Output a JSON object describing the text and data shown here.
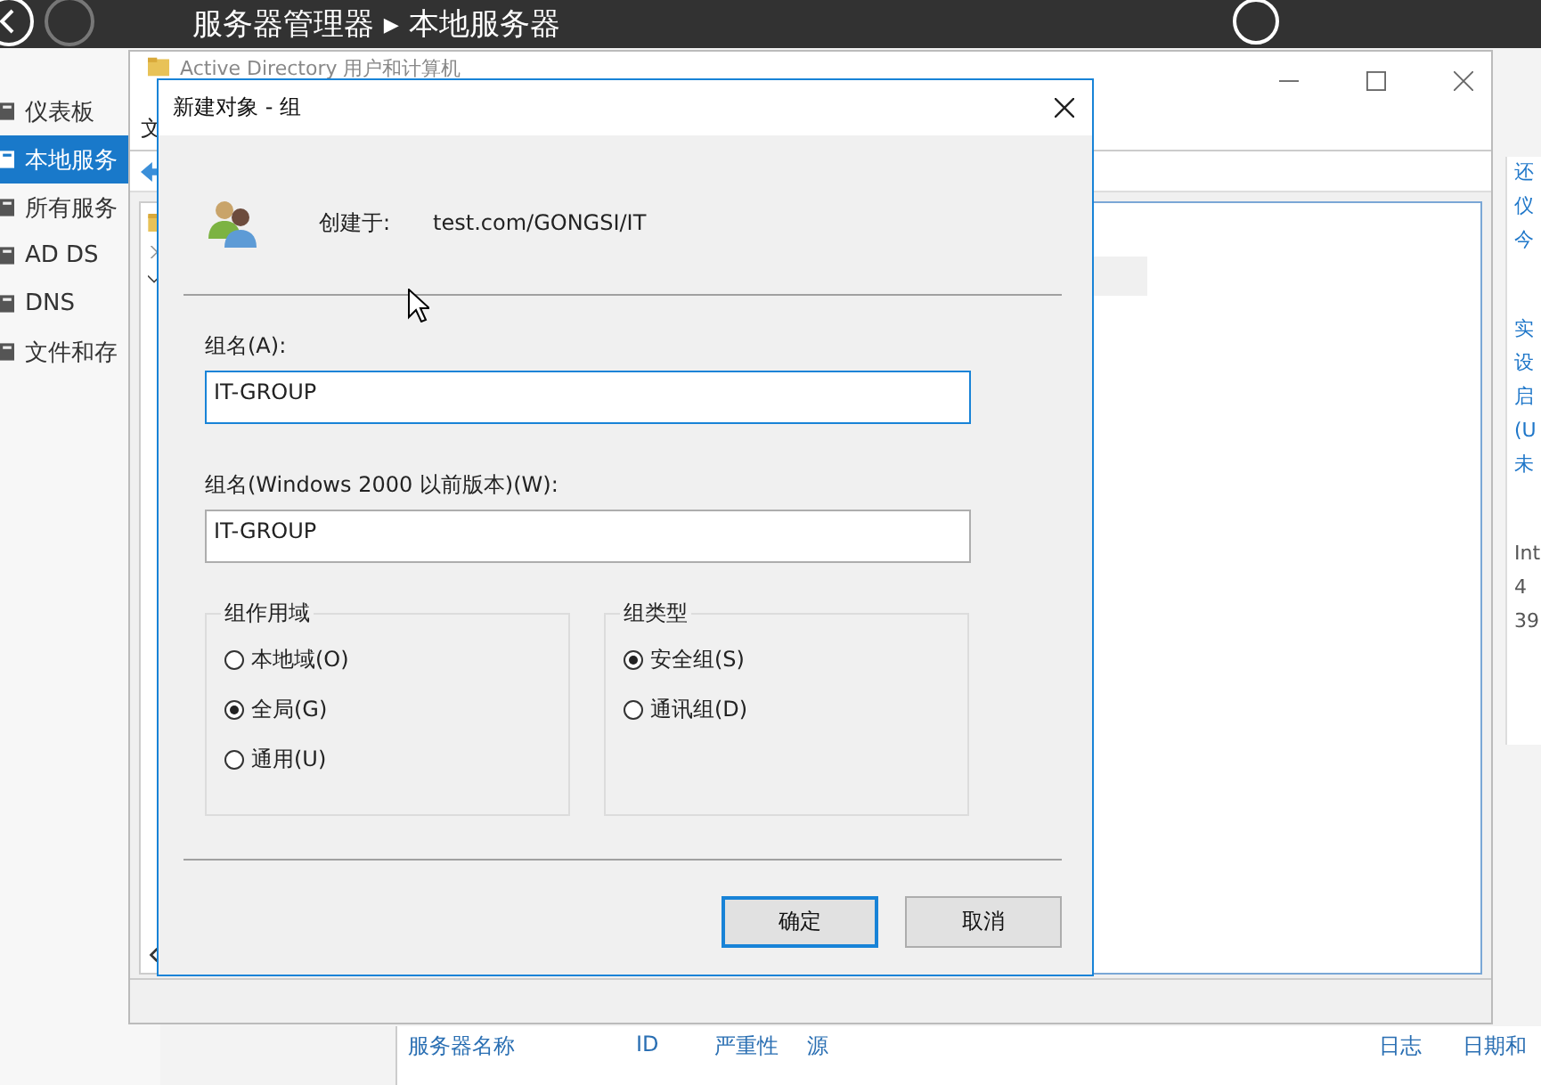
{
  "server_manager": {
    "title": "服务器管理器 ▸ 本地服务器",
    "nav": [
      {
        "label": "仪表板",
        "selected": false
      },
      {
        "label": "本地服务",
        "selected": true
      },
      {
        "label": "所有服务",
        "selected": false
      },
      {
        "label": "AD DS",
        "selected": false
      },
      {
        "label": "DNS",
        "selected": false
      },
      {
        "label": "文件和存",
        "selected": false
      }
    ],
    "side_links": [
      [
        "还",
        "仪",
        "今"
      ],
      [
        "实",
        "设",
        "启",
        "(U",
        "未"
      ]
    ],
    "side_info": [
      "Int",
      "4",
      "39"
    ],
    "events_columns": [
      "服务器名称",
      "ID",
      "严重性",
      "源",
      "日志",
      "日期和"
    ]
  },
  "ad_window": {
    "title": "Active Directory 用户和计算机",
    "menu": [
      "文"
    ]
  },
  "dialog": {
    "title": "新建对象 - 组",
    "created_in_label": "创建于:",
    "created_in_value": "test.com/GONGSI/IT",
    "fields": [
      {
        "label": "组名(A):",
        "value": "IT-GROUP",
        "focused": true
      },
      {
        "label": "组名(Windows 2000 以前版本)(W):",
        "value": "IT-GROUP",
        "focused": false
      }
    ],
    "groups": [
      {
        "title": "组作用域",
        "options": [
          {
            "label": "本地域(O)",
            "selected": false
          },
          {
            "label": "全局(G)",
            "selected": true
          },
          {
            "label": "通用(U)",
            "selected": false
          }
        ]
      },
      {
        "title": "组类型",
        "options": [
          {
            "label": "安全组(S)",
            "selected": true
          },
          {
            "label": "通讯组(D)",
            "selected": false
          }
        ]
      }
    ],
    "buttons": [
      {
        "label": "确定",
        "default": true
      },
      {
        "label": "取消",
        "default": false
      }
    ]
  }
}
